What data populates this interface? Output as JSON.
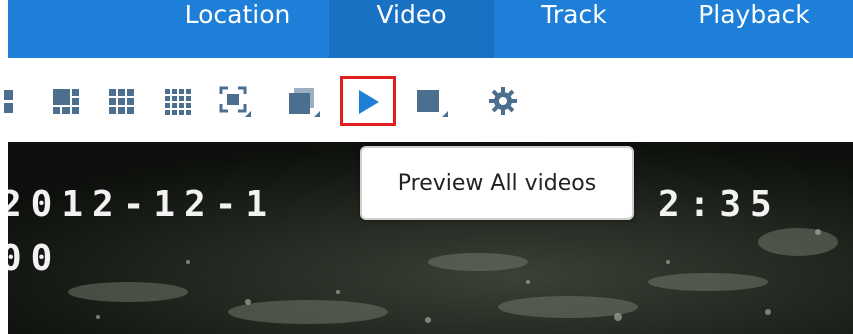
{
  "nav": {
    "tabs": [
      {
        "label": "Location"
      },
      {
        "label": "Video",
        "active": true
      },
      {
        "label": "Track"
      },
      {
        "label": "Playback"
      }
    ],
    "background_color": "#1e7fd8",
    "active_color": "#1971c4"
  },
  "toolbar": {
    "icons": [
      "layout-2x2-icon",
      "layout-1plus5-icon",
      "layout-3x3-icon",
      "layout-4x4-icon",
      "fullscreen-dropdown-icon",
      "window-dropdown-icon",
      "play-all-icon",
      "stop-dropdown-icon",
      "settings-gear-icon"
    ],
    "icon_color": "#4d6f8f",
    "play_color": "#1f7fd4",
    "highlight_color": "#e02020"
  },
  "video": {
    "osd_date": "2012-12-1",
    "osd_time": "2:35",
    "osd_sub": "00"
  },
  "tooltip": {
    "text": "Preview All videos"
  }
}
